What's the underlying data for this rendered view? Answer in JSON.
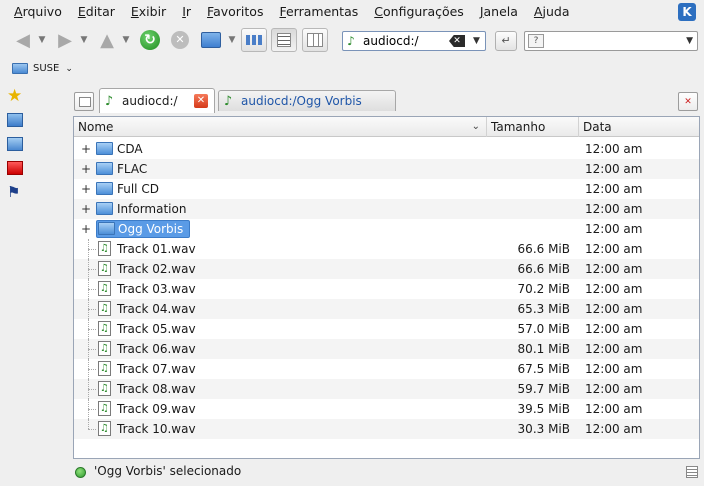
{
  "menubar": {
    "items": [
      "Arquivo",
      "Editar",
      "Exibir",
      "Ir",
      "Favoritos",
      "Ferramentas",
      "Configurações",
      "Janela",
      "Ajuda"
    ]
  },
  "toolbar": {
    "location_value": "audiocd:/",
    "search_value": ""
  },
  "bookmarks": {
    "folder_label": "SUSE"
  },
  "tabs": [
    {
      "label": "audiocd:/",
      "active": true
    },
    {
      "label": "audiocd:/Ogg Vorbis",
      "active": false
    }
  ],
  "file_view": {
    "columns": {
      "name": "Nome",
      "size": "Tamanho",
      "date": "Data"
    },
    "rows": [
      {
        "name": "CDA",
        "type": "folder",
        "size": "",
        "date": "12:00 am"
      },
      {
        "name": "FLAC",
        "type": "folder",
        "size": "",
        "date": "12:00 am"
      },
      {
        "name": "Full CD",
        "type": "folder",
        "size": "",
        "date": "12:00 am"
      },
      {
        "name": "Information",
        "type": "folder",
        "size": "",
        "date": "12:00 am"
      },
      {
        "name": "Ogg Vorbis",
        "type": "folder",
        "size": "",
        "date": "12:00 am",
        "selected": true
      },
      {
        "name": "Track 01.wav",
        "type": "wav",
        "size": "66.6 MiB",
        "date": "12:00 am"
      },
      {
        "name": "Track 02.wav",
        "type": "wav",
        "size": "66.6 MiB",
        "date": "12:00 am"
      },
      {
        "name": "Track 03.wav",
        "type": "wav",
        "size": "70.2 MiB",
        "date": "12:00 am"
      },
      {
        "name": "Track 04.wav",
        "type": "wav",
        "size": "65.3 MiB",
        "date": "12:00 am"
      },
      {
        "name": "Track 05.wav",
        "type": "wav",
        "size": "57.0 MiB",
        "date": "12:00 am"
      },
      {
        "name": "Track 06.wav",
        "type": "wav",
        "size": "80.1 MiB",
        "date": "12:00 am"
      },
      {
        "name": "Track 07.wav",
        "type": "wav",
        "size": "67.5 MiB",
        "date": "12:00 am"
      },
      {
        "name": "Track 08.wav",
        "type": "wav",
        "size": "59.7 MiB",
        "date": "12:00 am"
      },
      {
        "name": "Track 09.wav",
        "type": "wav",
        "size": "39.5 MiB",
        "date": "12:00 am"
      },
      {
        "name": "Track 10.wav",
        "type": "wav",
        "size": "30.3 MiB",
        "date": "12:00 am"
      }
    ]
  },
  "status": {
    "text": "'Ogg Vorbis' selecionado"
  },
  "colors": {
    "selection": "#5a9be6",
    "link_tab": "#1f56a8"
  }
}
